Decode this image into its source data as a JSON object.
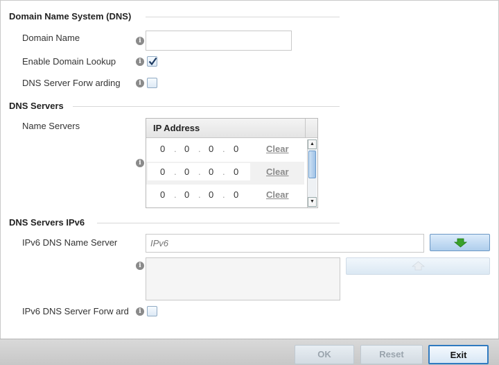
{
  "dns": {
    "title": "Domain Name System (DNS)",
    "domain_name_label": "Domain Name",
    "domain_name_value": "",
    "enable_lookup_label": "Enable Domain Lookup",
    "enable_lookup_checked": true,
    "forwarding_label": "DNS Server Forw arding",
    "forwarding_checked": false
  },
  "dns_servers": {
    "title": "DNS Servers",
    "name_servers_label": "Name Servers",
    "column_header": "IP Address",
    "rows": [
      {
        "octets": [
          "0",
          "0",
          "0",
          "0"
        ],
        "clear": "Clear"
      },
      {
        "octets": [
          "0",
          "0",
          "0",
          "0"
        ],
        "clear": "Clear"
      },
      {
        "octets": [
          "0",
          "0",
          "0",
          "0"
        ],
        "clear": "Clear"
      }
    ]
  },
  "dns_ipv6": {
    "title": "DNS Servers IPv6",
    "name_server_label": "IPv6 DNS Name Server",
    "name_server_placeholder": "IPv6",
    "forward_label": "IPv6 DNS Server Forw ard",
    "forward_checked": false
  },
  "footer": {
    "ok": "OK",
    "reset": "Reset",
    "exit": "Exit"
  },
  "colors": {
    "accent": "#2f7ac0",
    "add_arrow": "#3aa12a"
  }
}
